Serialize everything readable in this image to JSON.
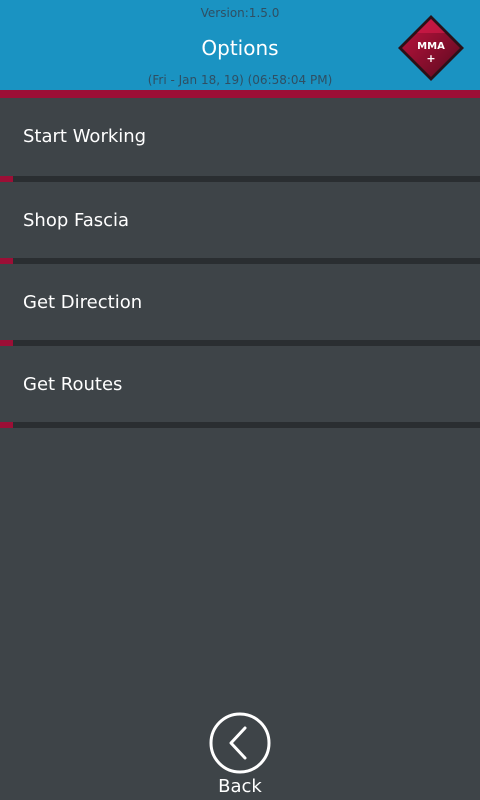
{
  "header": {
    "version": "Version:1.5.0",
    "title": "Options",
    "datetime": "(Fri - Jan 18, 19) (06:58:04 PM)",
    "logo_text": "MMA",
    "logo_plus": "+"
  },
  "menu": {
    "items": [
      {
        "label": "Start Working"
      },
      {
        "label": "Shop Fascia"
      },
      {
        "label": "Get Direction"
      },
      {
        "label": "Get Routes"
      }
    ]
  },
  "footer": {
    "back_label": "Back",
    "back_icon": "chevron-left-circle-icon"
  },
  "colors": {
    "header_bg": "#1a93c2",
    "accent": "#9c0f36",
    "body_bg": "#3e4448",
    "separator": "#2a2e31",
    "text": "#ffffff"
  }
}
